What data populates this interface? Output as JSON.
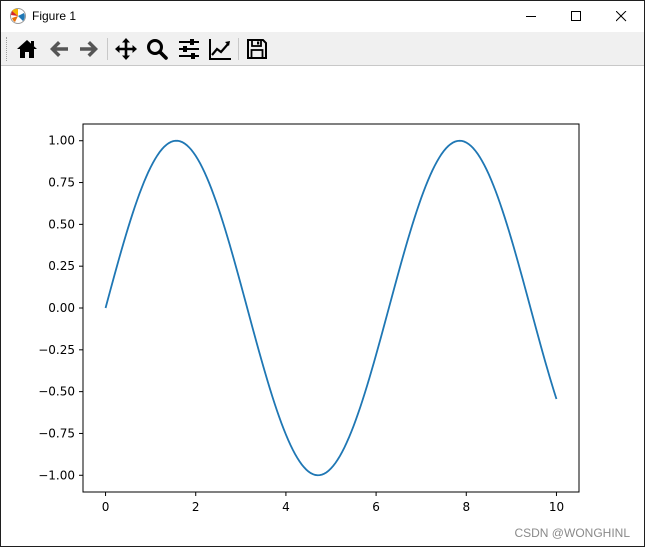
{
  "window": {
    "title": "Figure 1"
  },
  "toolbar": {
    "buttons": [
      {
        "name": "home",
        "icon": "home-icon"
      },
      {
        "name": "back",
        "icon": "arrow-left-icon"
      },
      {
        "name": "forward",
        "icon": "arrow-right-icon"
      },
      {
        "name": "pan",
        "icon": "move-icon"
      },
      {
        "name": "zoom",
        "icon": "zoom-icon"
      },
      {
        "name": "configure-subplots",
        "icon": "sliders-icon"
      },
      {
        "name": "edit-axis",
        "icon": "line-chart-icon"
      },
      {
        "name": "save",
        "icon": "floppy-disk-icon"
      }
    ]
  },
  "chart_data": {
    "type": "line",
    "function": "sin(x)",
    "x_range": [
      0,
      10
    ],
    "series": [
      {
        "color": "#1f77b4",
        "x": [
          0,
          0.5,
          1,
          1.5708,
          2,
          2.5,
          3,
          3.5,
          4,
          4.7124,
          5,
          5.5,
          6,
          6.5,
          7,
          7.854,
          8.5,
          9,
          9.5,
          10
        ],
        "y": [
          0,
          0.479,
          0.841,
          1.0,
          0.909,
          0.598,
          0.141,
          -0.351,
          -0.757,
          -1.0,
          -0.959,
          -0.706,
          -0.279,
          0.215,
          0.657,
          1.0,
          0.798,
          0.412,
          -0.075,
          -0.544
        ]
      }
    ],
    "xlim": [
      -0.5,
      10.5
    ],
    "ylim": [
      -1.1,
      1.1
    ],
    "x_ticks": [
      0,
      2,
      4,
      6,
      8,
      10
    ],
    "x_tick_labels": [
      "0",
      "2",
      "4",
      "6",
      "8",
      "10"
    ],
    "y_ticks": [
      1.0,
      0.75,
      0.5,
      0.25,
      0.0,
      -0.25,
      -0.5,
      -0.75,
      -1.0
    ],
    "y_tick_labels": [
      "1.00",
      "0.75",
      "0.50",
      "0.25",
      "0.00",
      "−0.25",
      "−0.50",
      "−0.75",
      "−1.00"
    ],
    "grid": false,
    "title": "",
    "xlabel": "",
    "ylabel": ""
  },
  "watermark": "CSDN @WONGHINL"
}
